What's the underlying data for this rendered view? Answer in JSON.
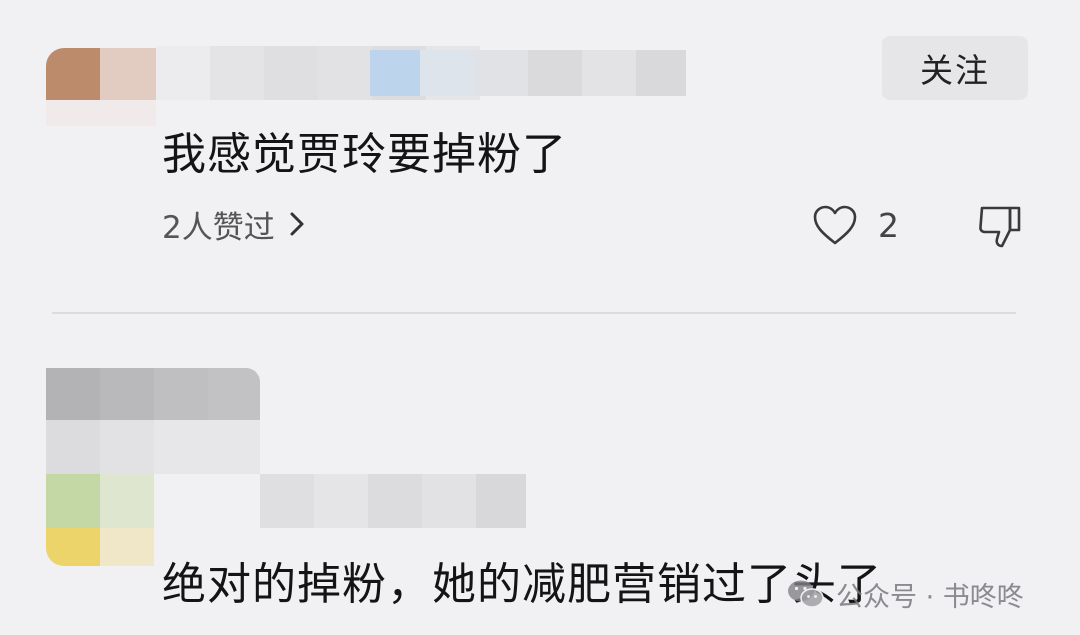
{
  "comments": [
    {
      "author_hidden": true,
      "follow_label": "关注",
      "text": "我感觉贾玲要掉粉了",
      "likers_text": "2人赞过",
      "like_count": "2"
    },
    {
      "author_hidden": true,
      "text": "绝对的掉粉，她的减肥营销过了头了"
    }
  ],
  "watermark": {
    "text": "公众号 · 书咚咚",
    "icon": "wechat-icon"
  },
  "colors": {
    "background": "#f1f1f3",
    "follow_button_bg": "#e6e6e8",
    "divider": "#dcdcdf"
  },
  "icons": [
    "chevron-right-icon",
    "heart-icon",
    "thumbs-down-icon",
    "wechat-icon"
  ]
}
